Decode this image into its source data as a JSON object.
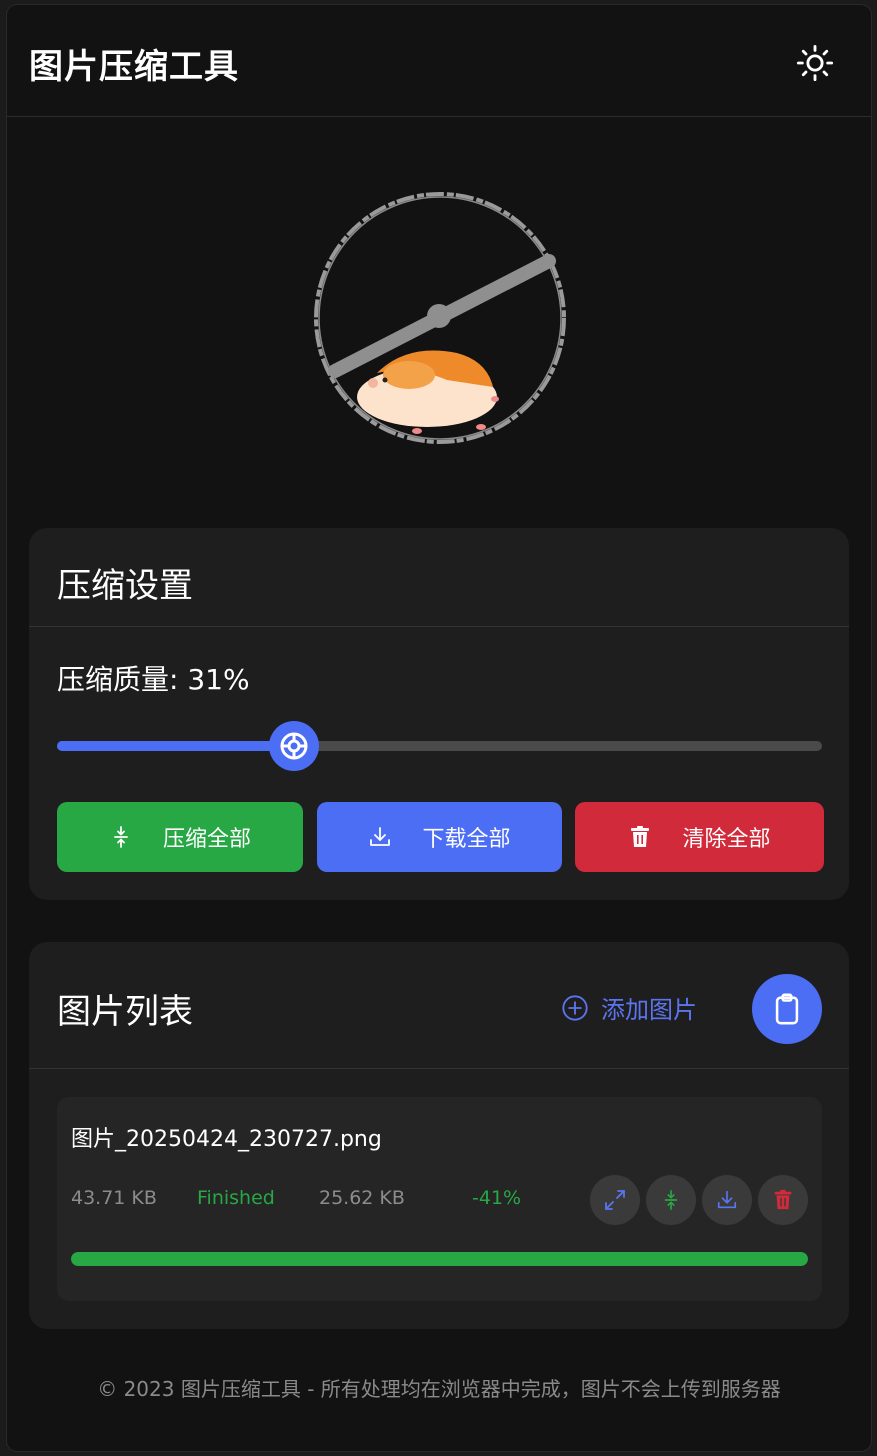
{
  "header": {
    "title": "图片压缩工具",
    "theme_icon": "sun-icon"
  },
  "settings": {
    "title": "压缩设置",
    "quality_label": "压缩质量: 31%",
    "quality_value": 31,
    "accent_color": "#4c6ef5",
    "buttons": {
      "compress_all": "压缩全部",
      "download_all": "下载全部",
      "clear_all": "清除全部"
    }
  },
  "list": {
    "title": "图片列表",
    "add_label": "添加图片",
    "items": [
      {
        "name": "图片_20250424_230727.png",
        "original_size": "43.71 KB",
        "status": "Finished",
        "compressed_size": "25.62 KB",
        "ratio": "-41%",
        "progress": 1.0
      }
    ]
  },
  "colors": {
    "success": "#28a745",
    "primary": "#4c6ef5",
    "danger": "#d12a3a"
  },
  "footer": {
    "text": "© 2023 图片压缩工具 - 所有处理均在浏览器中完成，图片不会上传到服务器"
  }
}
